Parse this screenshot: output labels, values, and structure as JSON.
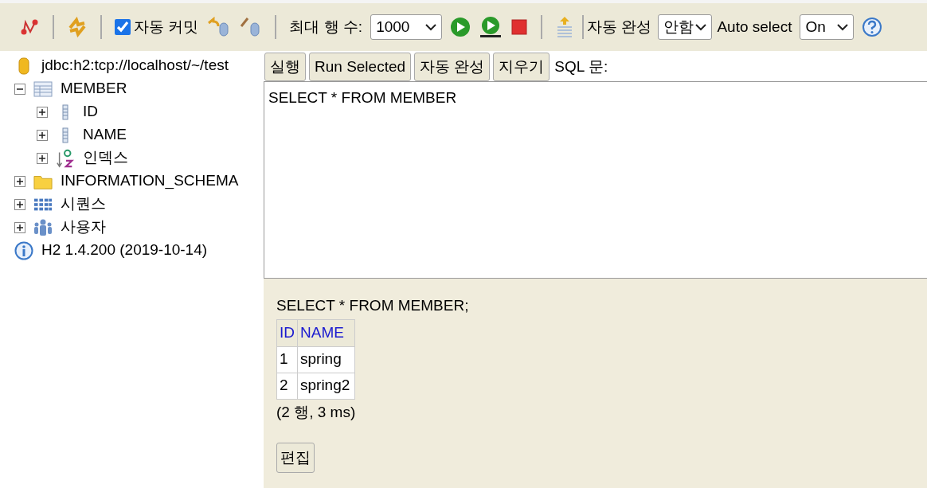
{
  "toolbar": {
    "auto_commit": {
      "label": "자동 커밋",
      "checked": true
    },
    "max_rows": {
      "label": "최대 행 수:",
      "value": "1000"
    },
    "autocomplete": {
      "label": "자동 완성",
      "value": "안함"
    },
    "auto_select": {
      "label": "Auto select",
      "value": "On"
    }
  },
  "tree": [
    {
      "kind": "database",
      "label": "jdbc:h2:tcp://localhost/~/test"
    },
    {
      "kind": "table",
      "label": "MEMBER",
      "expanded": true,
      "children": [
        {
          "kind": "column",
          "label": "ID",
          "expanded": false
        },
        {
          "kind": "column",
          "label": "NAME",
          "expanded": false
        },
        {
          "kind": "index",
          "label": "인덱스",
          "expanded": false
        }
      ]
    },
    {
      "kind": "folder",
      "label": "INFORMATION_SCHEMA",
      "expanded": false
    },
    {
      "kind": "sequence",
      "label": "시퀀스",
      "expanded": false
    },
    {
      "kind": "users",
      "label": "사용자",
      "expanded": false
    },
    {
      "kind": "info",
      "label": "H2 1.4.200 (2019-10-14)"
    }
  ],
  "query_buttons": [
    "실행",
    "Run Selected",
    "자동 완성",
    "지우기"
  ],
  "sql_label": "SQL 문:",
  "sql_text": "SELECT * FROM MEMBER",
  "result": {
    "statement": "SELECT * FROM MEMBER;",
    "columns": [
      "ID",
      "NAME"
    ],
    "rows": [
      [
        "1",
        "spring"
      ],
      [
        "2",
        "spring2"
      ]
    ],
    "summary": "(2 행, 3 ms)",
    "edit_button": "편집"
  }
}
